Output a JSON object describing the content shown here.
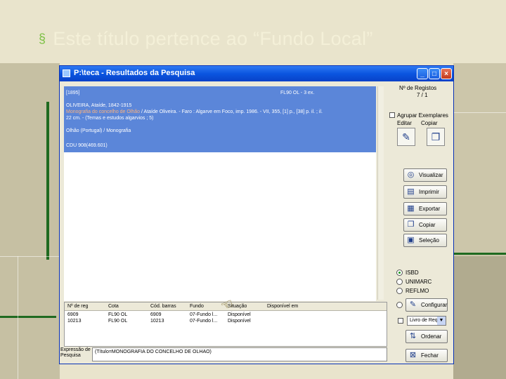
{
  "slide": {
    "bullet": "§",
    "title": "Este  título pertence ao “Fundo Local”"
  },
  "window": {
    "title": "P:\\teca - Resultados da Pesquisa",
    "minimize": "_",
    "maximize": "□",
    "close": "×"
  },
  "record": {
    "lines": [
      "[1895]",
      "OLIVEIRA, Ataíde, 1842-1915",
      "Monografia do concelho de Olhão / Ataíde Oliveira. - Faro : Algarve em Foco, imp. 1986. - VII, 355, [1] p., [38] p. il. ; il.",
      "22 cm. - (Temas e estudos algarvios ; 5)",
      "Olhão (Portugal) / Monografia",
      "CDU 908(469.601)"
    ],
    "location": "FL90 OL - 3 ex.",
    "orange_part": "Monografia do concelho de Olhão"
  },
  "sidebar": {
    "num_registos_label": "Nº de Registos",
    "num_registos_value": "7 / 1",
    "agrupar_label": "Agrupar Exemplares",
    "editar_label": "Editar",
    "copiar_label": "Copiar",
    "buttons": [
      "Visualizar",
      "Imprimir",
      "Exportar",
      "Copiar",
      "Seleção"
    ],
    "formats": [
      "ISBD",
      "UNIMARC",
      "REFLMO",
      ""
    ],
    "selected_format": 0,
    "configurar": "Configurar",
    "livro_select": "Livro de Req",
    "ordenar": "Ordenar",
    "fechar": "Fechar"
  },
  "results": {
    "columns": [
      "Nº de reg",
      "Cota",
      "Cód. barras",
      "Fundo",
      "Situação",
      "Disponível em"
    ],
    "rows": [
      [
        "6909",
        "FL90 OL",
        "6909",
        "07-Fundo l...",
        "Disponível",
        ""
      ],
      [
        "10213",
        "FL90 OL",
        "10213",
        "07-Fundo l...",
        "Disponível",
        ""
      ]
    ]
  },
  "search_expression": {
    "label": "Expressão de Pesquisa",
    "value": "(Título=MONOGRAFIA DO CONCELHO DE OLHAO)"
  },
  "colors": {
    "record_bg": "#5b86d9",
    "titlebar": "#0b55e0",
    "slide_green": "#1f6a20"
  }
}
